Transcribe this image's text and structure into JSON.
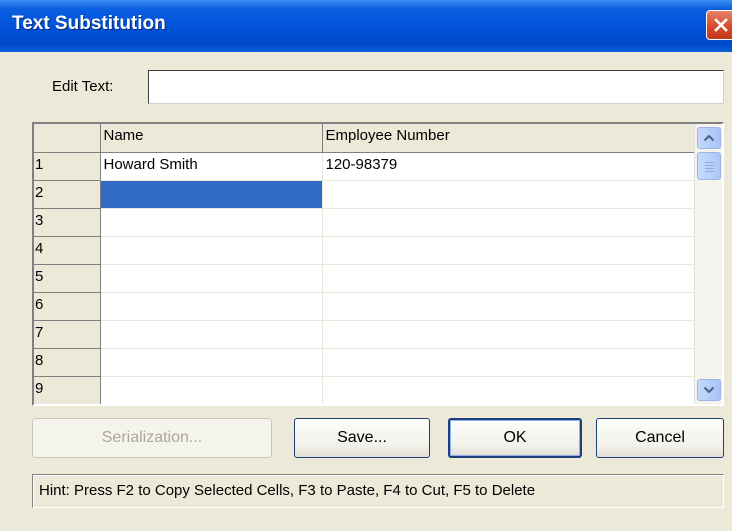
{
  "window": {
    "title": "Text Substitution"
  },
  "edit_text": {
    "label": "Edit Text:",
    "value": ""
  },
  "grid": {
    "columns": [
      "Name",
      "Employee Number"
    ],
    "rows": [
      {
        "num": "1",
        "name": "Howard Smith",
        "employee_number": "120-98379"
      },
      {
        "num": "2",
        "name": "",
        "employee_number": ""
      },
      {
        "num": "3",
        "name": "",
        "employee_number": ""
      },
      {
        "num": "4",
        "name": "",
        "employee_number": ""
      },
      {
        "num": "5",
        "name": "",
        "employee_number": ""
      },
      {
        "num": "6",
        "name": "",
        "employee_number": ""
      },
      {
        "num": "7",
        "name": "",
        "employee_number": ""
      },
      {
        "num": "8",
        "name": "",
        "employee_number": ""
      },
      {
        "num": "9",
        "name": "",
        "employee_number": ""
      }
    ],
    "selected_row": 2,
    "selected_column": "Name",
    "selection_color": "#316ac5"
  },
  "buttons": {
    "serialization": "Serialization...",
    "save": "Save...",
    "ok": "OK",
    "cancel": "Cancel"
  },
  "hint": "Hint: Press F2 to Copy Selected Cells, F3 to Paste, F4 to Cut, F5 to Delete",
  "icons": {
    "close": "close-icon",
    "scroll_up": "chevron-up-icon",
    "scroll_down": "chevron-down-icon"
  }
}
